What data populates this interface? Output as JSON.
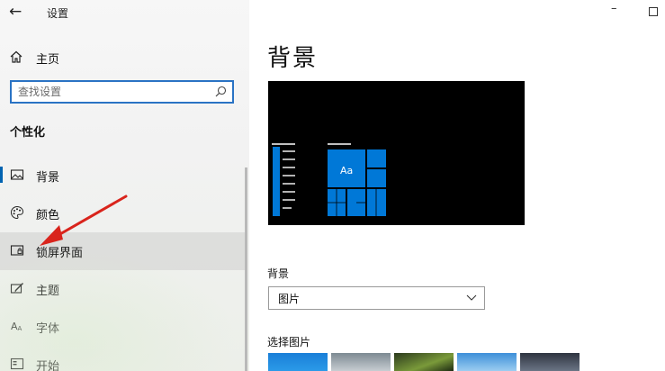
{
  "window": {
    "title": "设置"
  },
  "sidebar": {
    "home_label": "主页",
    "search_placeholder": "查找设置",
    "section_title": "个性化",
    "items": [
      {
        "label": "背景",
        "icon": "image-icon",
        "selected": true
      },
      {
        "label": "颜色",
        "icon": "palette-icon"
      },
      {
        "label": "锁屏界面",
        "icon": "lock-screen-icon",
        "hovered": true
      },
      {
        "label": "主题",
        "icon": "theme-icon"
      },
      {
        "label": "字体",
        "icon": "font-icon"
      },
      {
        "label": "开始",
        "icon": "start-icon"
      }
    ]
  },
  "main": {
    "page_title": "背景",
    "preview": {
      "tile_text": "Aa"
    },
    "background_label": "背景",
    "background_select_value": "图片",
    "choose_picture_label": "选择图片"
  },
  "colors": {
    "accent": "#0078d7",
    "annotation_arrow": "#d9241c"
  }
}
